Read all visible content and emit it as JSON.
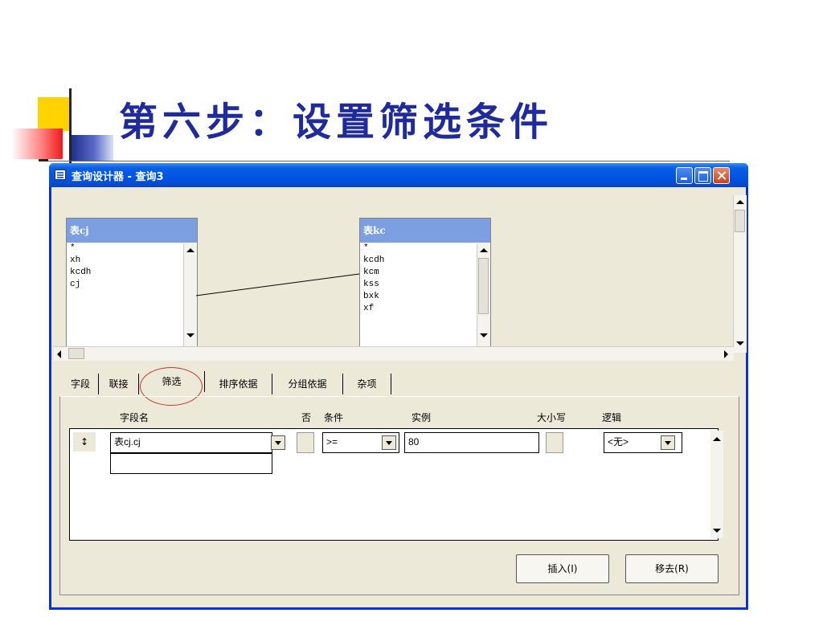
{
  "slide": {
    "title": "第六步：设置筛选条件"
  },
  "window": {
    "title": "查询设计器 - 查询3"
  },
  "tables": [
    {
      "name": "表cj",
      "fields": [
        "*",
        "xh",
        "kcdh",
        "cj"
      ]
    },
    {
      "name": "表kc",
      "fields": [
        "*",
        "kcdh",
        "kcm",
        "kss",
        "bxk",
        "xf"
      ]
    }
  ],
  "tabs": [
    "字段",
    "联接",
    "筛选",
    "排序依据",
    "分组依据",
    "杂项"
  ],
  "active_tab": "筛选",
  "filter": {
    "headers": {
      "field": "字段名",
      "not": "否",
      "condition": "条件",
      "example": "实例",
      "case": "大小写",
      "logic": "逻辑"
    },
    "row": {
      "field": "表cj.cj",
      "condition": ">=",
      "example": "80",
      "logic": "<无>"
    }
  },
  "buttons": {
    "insert": "插入(I)",
    "remove": "移去(R)"
  },
  "colors": {
    "title_text": "#1f2a9c",
    "titlebar": "#0054e3",
    "table_header": "#7b9fe0",
    "annotation_circle": "#c0392b"
  }
}
